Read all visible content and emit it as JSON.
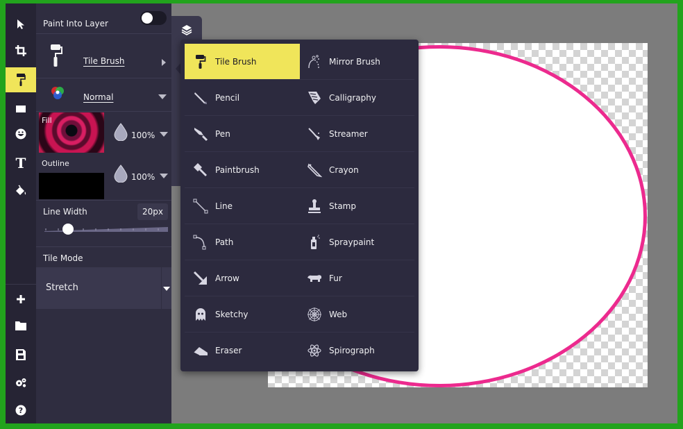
{
  "panel": {
    "paint_into_layer_label": "Paint Into Layer",
    "brush_name": "Tile Brush",
    "blend_mode": "Normal",
    "fill_label": "Fill",
    "fill_opacity": "100%",
    "outline_label": "Outline",
    "outline_opacity": "100%",
    "line_width_label": "Line Width",
    "line_width_value": "20px",
    "tile_mode_label": "Tile Mode",
    "tile_mode_value": "Stretch",
    "line_width_slider_fraction": 0.2
  },
  "rail_tools": [
    {
      "icon": "cursor-icon"
    },
    {
      "icon": "crop-icon"
    },
    {
      "icon": "paint-roller-icon",
      "active": true
    },
    {
      "icon": "rectangle-icon"
    },
    {
      "icon": "emoji-icon"
    },
    {
      "icon": "text-icon",
      "glyph": "T"
    },
    {
      "icon": "paint-bucket-icon"
    },
    {
      "icon": "plus-icon"
    },
    {
      "icon": "folder-icon"
    },
    {
      "icon": "save-icon"
    },
    {
      "icon": "settings-icon"
    },
    {
      "icon": "help-icon"
    }
  ],
  "brush_menu": {
    "items": [
      {
        "label": "Tile Brush",
        "icon": "paint-roller-icon",
        "selected": true
      },
      {
        "label": "Mirror Brush",
        "icon": "mirror-brush-icon"
      },
      {
        "label": "Pencil",
        "icon": "pencil-icon"
      },
      {
        "label": "Calligraphy",
        "icon": "calligraphy-icon"
      },
      {
        "label": "Pen",
        "icon": "pen-icon"
      },
      {
        "label": "Streamer",
        "icon": "streamer-icon"
      },
      {
        "label": "Paintbrush",
        "icon": "paintbrush-icon"
      },
      {
        "label": "Crayon",
        "icon": "crayon-icon"
      },
      {
        "label": "Line",
        "icon": "line-icon"
      },
      {
        "label": "Stamp",
        "icon": "stamp-icon"
      },
      {
        "label": "Path",
        "icon": "path-icon"
      },
      {
        "label": "Spraypaint",
        "icon": "spraypaint-icon"
      },
      {
        "label": "Arrow",
        "icon": "arrow-icon"
      },
      {
        "label": "Fur",
        "icon": "fur-icon"
      },
      {
        "label": "Sketchy",
        "icon": "sketchy-icon"
      },
      {
        "label": "Web",
        "icon": "web-icon"
      },
      {
        "label": "Eraser",
        "icon": "eraser-icon"
      },
      {
        "label": "Spirograph",
        "icon": "spirograph-icon"
      }
    ]
  },
  "colors": {
    "accent": "#f0e55a",
    "stroke": "#ec2a8e",
    "frame": "#22a31d",
    "panel_bg": "#2f2d40"
  }
}
